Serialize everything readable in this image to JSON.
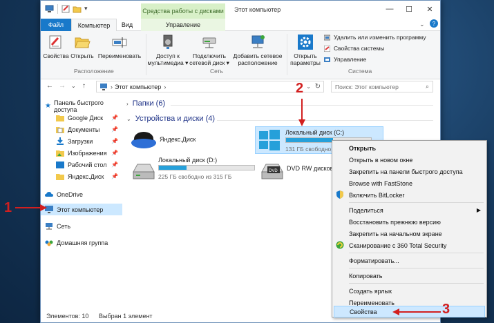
{
  "window": {
    "title": "Этот компьютер",
    "context_tab_title": "Средства работы с дисками",
    "controls": {
      "minimize": "—",
      "maximize": "☐",
      "close": "✕"
    }
  },
  "tabs": [
    {
      "label": "Файл"
    },
    {
      "label": "Компьютер"
    },
    {
      "label": "Вид"
    },
    {
      "label": "Управление"
    }
  ],
  "ribbon": {
    "groups": {
      "location": {
        "label": "Расположение",
        "buttons": [
          {
            "label": "Свойства",
            "icon": "properties-icon"
          },
          {
            "label": "Открыть",
            "icon": "open-folder-icon"
          },
          {
            "label": "Переименовать",
            "icon": "rename-icon"
          }
        ]
      },
      "network": {
        "label": "Сеть",
        "buttons": [
          {
            "line1": "Доступ к",
            "line2": "мультимедиа ▾",
            "icon": "media-access-icon"
          },
          {
            "line1": "Подключить",
            "line2": "сетевой диск ▾",
            "icon": "network-drive-icon"
          },
          {
            "line1": "Добавить сетевое",
            "line2": "расположение",
            "icon": "add-network-location-icon"
          }
        ]
      },
      "system": {
        "label": "Система",
        "open_settings": {
          "line1": "Открыть",
          "line2": "параметры",
          "icon": "gear-icon"
        },
        "items": [
          {
            "label": "Удалить или изменить программу"
          },
          {
            "label": "Свойства системы"
          },
          {
            "label": "Управление"
          }
        ]
      }
    }
  },
  "address": {
    "path_root": "Этот компьютер",
    "path_chevron": "›",
    "search_placeholder": "Поиск: Этот компьютер"
  },
  "nav": {
    "items": [
      {
        "label": "Панель быстрого доступа",
        "pinned": false
      },
      {
        "label": "Google Диск",
        "pinned": true
      },
      {
        "label": "Документы",
        "pinned": true
      },
      {
        "label": "Загрузки",
        "pinned": true
      },
      {
        "label": "Изображения",
        "pinned": true
      },
      {
        "label": "Рабочий стол",
        "pinned": true
      },
      {
        "label": "Яндекс.Диск",
        "pinned": true
      },
      {
        "label": "OneDrive",
        "pinned": false
      },
      {
        "label": "Этот компьютер",
        "pinned": false,
        "selected": true
      },
      {
        "label": "Сеть",
        "pinned": false
      },
      {
        "label": "Домашняя группа",
        "pinned": false
      }
    ]
  },
  "content": {
    "folders_header": "Папки (6)",
    "devices_header": "Устройства и диски (4)",
    "drives": [
      {
        "name": "Яндекс.Диск"
      },
      {
        "name": "Локальный диск (C:)",
        "free": "131 ГБ свободно",
        "fill": 0.55
      },
      {
        "name": "Локальный диск (D:)",
        "free": "225 ГБ свободно из 315 ГБ",
        "fill": 0.29
      },
      {
        "name": "DVD RW дисково"
      }
    ]
  },
  "status": {
    "items_count": "Элементов: 10",
    "selected": "Выбран 1 элемент"
  },
  "context_menu": {
    "items": [
      {
        "label": "Открыть",
        "bold": true
      },
      {
        "label": "Открыть в новом окне"
      },
      {
        "label": "Закрепить на панели быстрого доступа"
      },
      {
        "label": "Browse with FastStone"
      },
      {
        "label": "Включить BitLocker",
        "icon": "shield-icon"
      },
      {
        "label": "Поделиться",
        "submenu": true
      },
      {
        "label": "Восстановить прежнюю версию"
      },
      {
        "label": "Закрепить на начальном экране"
      },
      {
        "label": "Сканирование с 360 Total Security",
        "icon": "total-security-icon"
      },
      {
        "label": "Форматировать..."
      },
      {
        "label": "Копировать"
      },
      {
        "label": "Создать ярлык"
      },
      {
        "label": "Переименовать"
      },
      {
        "label": "Свойства",
        "highlighted": true
      }
    ]
  },
  "annotations": {
    "step1": "1",
    "step2": "2",
    "step3": "3"
  },
  "colors": {
    "accent": "#1979ca",
    "annotation": "#d21f1f",
    "highlight": "#cde8ff",
    "drive_fill": "#26a0da"
  }
}
